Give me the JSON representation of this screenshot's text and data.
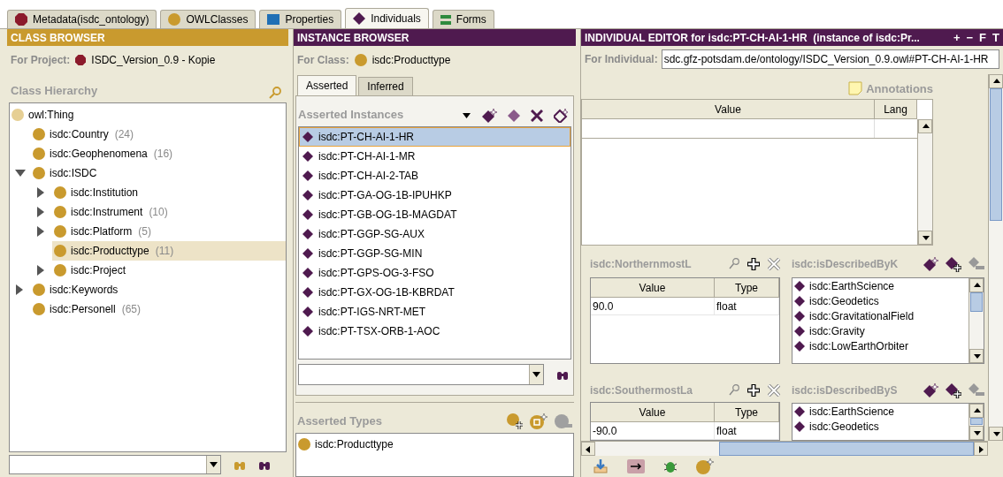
{
  "tabs": [
    {
      "kind": "metadata",
      "label": "Metadata(isdc_ontology)",
      "selected": false
    },
    {
      "kind": "class",
      "label": "OWLClasses",
      "selected": false
    },
    {
      "kind": "property",
      "label": "Properties",
      "selected": false
    },
    {
      "kind": "individual",
      "label": "Individuals",
      "selected": true
    },
    {
      "kind": "forms",
      "label": "Forms",
      "selected": false
    }
  ],
  "class_browser": {
    "title": "CLASS BROWSER",
    "project_label": "For Project:",
    "project_name": "ISDC_Version_0.9 - Kopie",
    "hierarchy_title": "Class Hierarchy",
    "tree": [
      {
        "label": "owl:Thing",
        "color": "#e6cf94",
        "selected": false,
        "children": [
          {
            "label": "isdc:Country",
            "count": "(24)",
            "color": "#c99a2e",
            "selected": false
          },
          {
            "label": "isdc:Geophenomena",
            "count": "(16)",
            "color": "#c99a2e",
            "selected": false
          },
          {
            "label": "isdc:ISDC",
            "color": "#c99a2e",
            "expanded": true,
            "selected": false,
            "children": [
              {
                "label": "isdc:Institution",
                "color": "#c99a2e",
                "expanded": false,
                "selected": false
              },
              {
                "label": "isdc:Instrument",
                "count": "(10)",
                "color": "#c99a2e",
                "expanded": false,
                "selected": false
              },
              {
                "label": "isdc:Platform",
                "count": "(5)",
                "color": "#c99a2e",
                "expanded": false,
                "selected": false
              },
              {
                "label": "isdc:Producttype",
                "count": "(11)",
                "color": "#c99a2e",
                "selected": true
              },
              {
                "label": "isdc:Project",
                "color": "#c99a2e",
                "expanded": false,
                "selected": false
              }
            ]
          },
          {
            "label": "isdc:Keywords",
            "color": "#c99a2e",
            "expanded": false,
            "selected": false
          },
          {
            "label": "isdc:Personell",
            "count": "(65)",
            "color": "#c99a2e",
            "selected": false
          }
        ]
      }
    ]
  },
  "instance_browser": {
    "title": "INSTANCE BROWSER",
    "class_label": "For Class:",
    "class_name": "isdc:Producttype",
    "subtabs": [
      {
        "label": "Asserted",
        "selected": true
      },
      {
        "label": "Inferred",
        "selected": false
      }
    ],
    "instances_title": "Asserted Instances",
    "instances": [
      {
        "label": "isdc:PT-CH-AI-1-HR",
        "selected": true
      },
      {
        "label": "isdc:PT-CH-AI-1-MR",
        "selected": false
      },
      {
        "label": "isdc:PT-CH-AI-2-TAB",
        "selected": false
      },
      {
        "label": "isdc:PT-GA-OG-1B-IPUHKP",
        "selected": false
      },
      {
        "label": "isdc:PT-GB-OG-1B-MAGDAT",
        "selected": false
      },
      {
        "label": "isdc:PT-GGP-SG-AUX",
        "selected": false
      },
      {
        "label": "isdc:PT-GGP-SG-MIN",
        "selected": false
      },
      {
        "label": "isdc:PT-GPS-OG-3-FSO",
        "selected": false
      },
      {
        "label": "isdc:PT-GX-OG-1B-KBRDAT",
        "selected": false
      },
      {
        "label": "isdc:PT-IGS-NRT-MET",
        "selected": false
      },
      {
        "label": "isdc:PT-TSX-ORB-1-AOC",
        "selected": false
      }
    ],
    "types_title": "Asserted Types",
    "types": [
      "isdc:Producttype"
    ]
  },
  "individual_editor": {
    "title": "INDIVIDUAL EDITOR for isdc:PT-CH-AI-1-HR  (instance of isdc:Pr...",
    "header_buttons": [
      "+",
      "−",
      "F",
      "T"
    ],
    "individual_label": "For Individual:",
    "individual_uri": "sdc.gfz-potsdam.de/ontology/ISDC_Version_0.9.owl#PT-CH-AI-1-HR",
    "annotations_title": "Annotations",
    "annotation_columns": [
      "Value",
      "Lang"
    ],
    "property_rows": [
      {
        "datatype": {
          "title": "isdc:NorthernmostL",
          "columns": [
            "Value",
            "Type"
          ],
          "rows": [
            [
              "90.0",
              "float"
            ]
          ]
        },
        "object": {
          "title": "isdc:isDescribedByK",
          "items": [
            "isdc:EarthScience",
            "isdc:Geodetics",
            "isdc:GravitationalField",
            "isdc:Gravity",
            "isdc:LowEarthOrbiter"
          ]
        }
      },
      {
        "datatype": {
          "title": "isdc:SouthermostLa",
          "columns": [
            "Value",
            "Type"
          ],
          "rows": [
            [
              "-90.0",
              "float"
            ]
          ]
        },
        "object": {
          "title": "isdc:isDescribedByS",
          "items": [
            "isdc:EarthScience",
            "isdc:Geodetics"
          ]
        }
      }
    ]
  }
}
